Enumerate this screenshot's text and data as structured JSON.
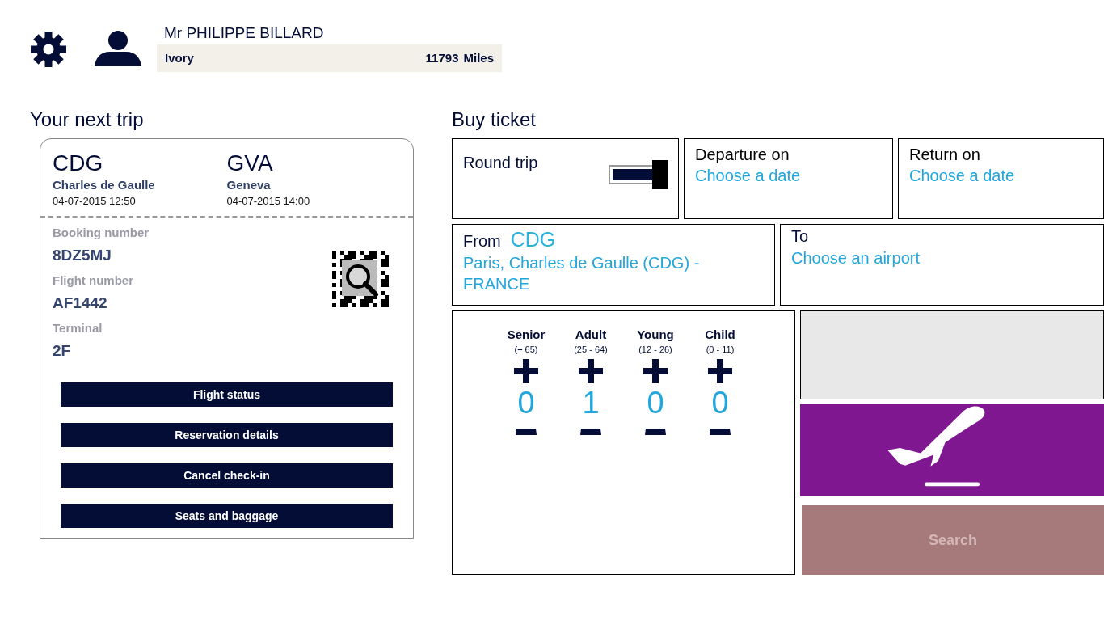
{
  "profile": {
    "name": "Mr PHILIPPE BILLARD",
    "tier": "Ivory",
    "miles": "11793",
    "miles_unit": "Miles"
  },
  "next_trip": {
    "title": "Your next trip",
    "origin": {
      "code": "CDG",
      "airport": "Charles de Gaulle",
      "datetime": "04-07-2015 12:50"
    },
    "destination": {
      "code": "GVA",
      "airport": "Geneva",
      "datetime": "04-07-2015 14:00"
    },
    "details": [
      {
        "label": "Booking number",
        "value": "8DZ5MJ"
      },
      {
        "label": "Flight number",
        "value": "AF1442"
      },
      {
        "label": "Terminal",
        "value": "2F"
      }
    ],
    "buttons": [
      "Flight status",
      "Reservation details",
      "Cancel check-in",
      "Seats and baggage"
    ]
  },
  "buy_ticket": {
    "title": "Buy ticket",
    "round_trip": {
      "label": "Round trip",
      "on": true
    },
    "departure": {
      "label": "Departure on",
      "value": "Choose a date"
    },
    "return": {
      "label": "Return on",
      "value": "Choose a date"
    },
    "from": {
      "label": "From",
      "code": "CDG",
      "value": "Paris, Charles de Gaulle (CDG) - FRANCE"
    },
    "to": {
      "label": "To",
      "value": "Choose an airport"
    },
    "passengers": [
      {
        "label": "Senior",
        "range": "(+ 65)",
        "count": "0"
      },
      {
        "label": "Adult",
        "range": "(25 - 64)",
        "count": "1"
      },
      {
        "label": "Young",
        "range": "(12 - 26)",
        "count": "0"
      },
      {
        "label": "Child",
        "range": "(0 - 11)",
        "count": "0"
      }
    ],
    "search": {
      "label": "Search",
      "disabled": true
    }
  }
}
